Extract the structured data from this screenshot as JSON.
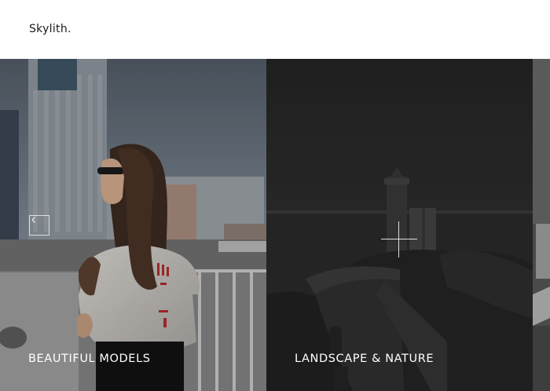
{
  "header": {
    "logo": "Skylith."
  },
  "slider": {
    "slides": [
      {
        "title": "BEAUTIFUL MODELS"
      },
      {
        "title": "LANDSCAPE & NATURE"
      },
      {
        "title": ""
      }
    ],
    "prev_icon": "chevron-left-icon",
    "hover_icon": "plus-icon"
  },
  "colors": {
    "header_bg": "#ffffff",
    "logo_text": "#1a1a1a",
    "caption_text": "#ffffff",
    "dark_overlay": "#1e1e1e"
  }
}
